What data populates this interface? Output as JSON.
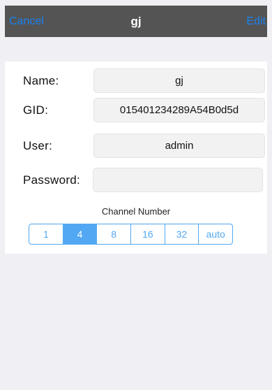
{
  "navbar": {
    "cancel_label": "Cancel",
    "title": "gj",
    "edit_label": "Edit"
  },
  "form": {
    "name_label": "Name:",
    "name_value": "gj",
    "gid_label": "GID:",
    "gid_value": "015401234289A54B0d5d",
    "user_label": "User:",
    "user_value": "admin",
    "password_label": "Password:",
    "password_value": ""
  },
  "channel": {
    "title": "Channel Number",
    "options": [
      "1",
      "4",
      "8",
      "16",
      "32",
      "auto"
    ],
    "selected": "4"
  },
  "colors": {
    "accent": "#52a8f2",
    "navbar": "#545454",
    "background": "#efeff4"
  }
}
